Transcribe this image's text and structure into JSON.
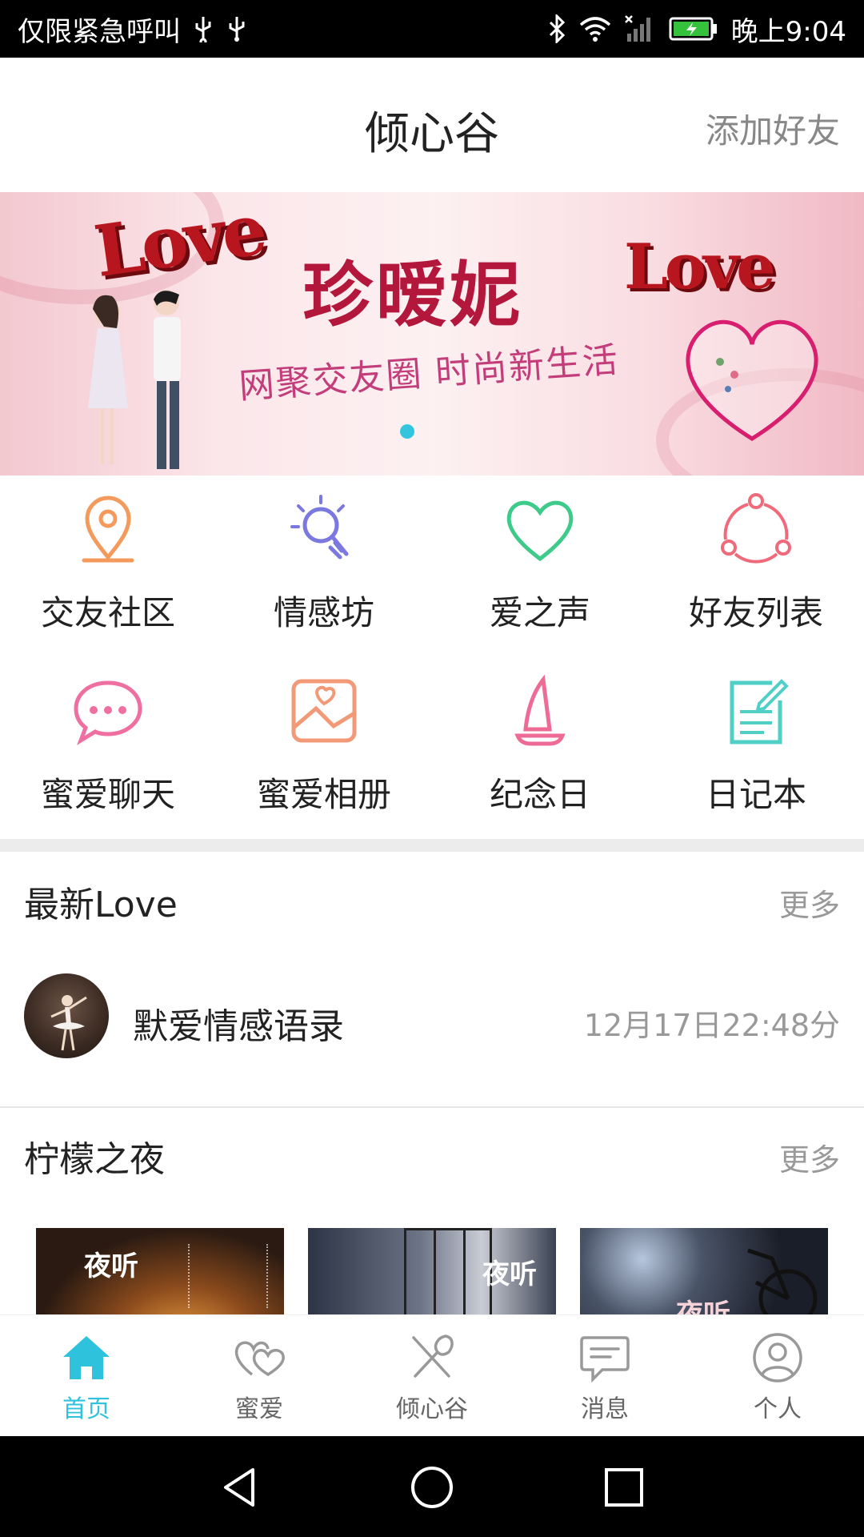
{
  "status_bar": {
    "left_text": "仅限紧急呼叫",
    "time": "晚上9:04",
    "icons": [
      "usb-icon",
      "usb-icon",
      "bluetooth-icon",
      "wifi-icon",
      "signal-icon",
      "battery-icon"
    ]
  },
  "header": {
    "title": "倾心谷",
    "add_friend": "添加好友"
  },
  "banner": {
    "love_left": "Love",
    "love_right": "Love",
    "brand": "珍暧妮",
    "slogan": "网聚交友圈 时尚新生活"
  },
  "features": [
    {
      "label": "交友社区",
      "icon": "location-pin-icon",
      "color": "#f39a5c"
    },
    {
      "label": "情感坊",
      "icon": "lightbulb-icon",
      "color": "#7b78e0"
    },
    {
      "label": "爱之声",
      "icon": "heart-icon",
      "color": "#3ecb8a"
    },
    {
      "label": "好友列表",
      "icon": "share-nodes-icon",
      "color": "#ef6a7a"
    },
    {
      "label": "蜜爱聊天",
      "icon": "chat-bubble-icon",
      "color": "#ee6fa0"
    },
    {
      "label": "蜜爱相册",
      "icon": "photo-album-icon",
      "color": "#f29a78"
    },
    {
      "label": "纪念日",
      "icon": "sailboat-icon",
      "color": "#ee6b95"
    },
    {
      "label": "日记本",
      "icon": "notebook-icon",
      "color": "#4fcfc6"
    }
  ],
  "latest": {
    "title": "最新Love",
    "more": "更多",
    "item_title": "默爱情感语录",
    "item_time": "12月17日22:48分"
  },
  "night": {
    "title": "柠檬之夜",
    "more": "更多",
    "thumbs": [
      {
        "caption": "夜听"
      },
      {
        "caption": "夜听"
      },
      {
        "caption": "夜听"
      }
    ]
  },
  "bottom_nav": [
    {
      "label": "首页",
      "icon": "home-icon",
      "active": true
    },
    {
      "label": "蜜爱",
      "icon": "hearts-icon",
      "active": false
    },
    {
      "label": "倾心谷",
      "icon": "utensils-icon",
      "active": false
    },
    {
      "label": "消息",
      "icon": "message-icon",
      "active": false
    },
    {
      "label": "个人",
      "icon": "user-icon",
      "active": false
    }
  ],
  "colors": {
    "accent": "#2fc2dc",
    "banner_dot": "#33c5dd"
  }
}
